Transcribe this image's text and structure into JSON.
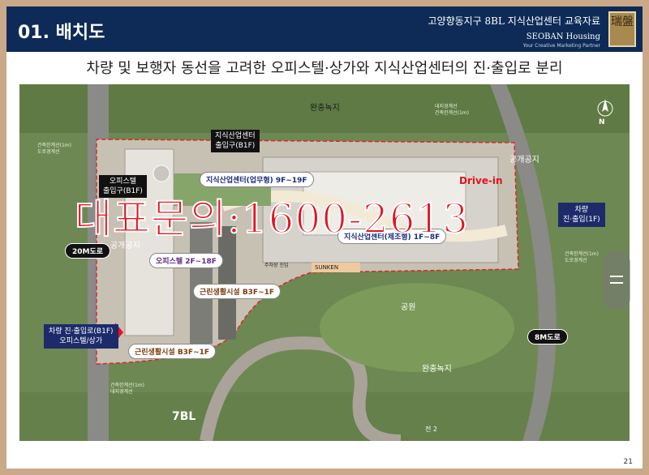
{
  "header": {
    "section_title": "01. 배치도",
    "document_title": "고양향동지구 8BL 지식산업센터 교육자료",
    "brand_name": "SEOBAN Housing",
    "brand_tagline": "Your Creative Marketing Partner",
    "seal_text": "瑞盤"
  },
  "subtitle": "차량 및 보행자 동선을 고려한 오피스텔·상가와 지식산업센터의 진·출입로 분리",
  "map": {
    "labels": {
      "buffer_green_top": "완충녹지",
      "buffer_green_bottom": "완충녹지",
      "park": "공원",
      "public_space_right": "공개공지",
      "public_space_left": "공개공지",
      "sunken": "SUNKEN",
      "block_7": "7BL",
      "drive_in": "Drive-in",
      "parking_entrance": "주차장 진입",
      "watermark": "대표문의:1600-2613",
      "north": "N"
    },
    "tags": {
      "kic_entrance": "지식산업센터\n출입구(B1F)",
      "officetel_entrance": "오피스텔\n출입구(B1F)",
      "vehicle_entrance": "차량 진·출입로(B1F)\n오피스텔/상가",
      "kic_entrance_right": "차량\n진·출입(1F)"
    },
    "chips": {
      "kic_office": "지식산업센터(업무형) 9F~19F",
      "kic_factory": "지식산업센터(제조형) 1F~8F",
      "officetel": "오피스텔 2F~18F",
      "retail_1": "근린생활시설 B3F~1F",
      "retail_2": "근린생활시설 B3F~1F"
    },
    "roads": {
      "road_20m": "20M도로",
      "road_8m": "8M도로"
    },
    "boundary_notes": {
      "top": "대지경계선\n건축한계선(1m)",
      "left": "건축한계선(1m)\n도로경계선",
      "right": "건축한계선(1m)\n도로경계선",
      "bottom": "건축한계선(1m)\n대지경계선"
    }
  },
  "footer": {
    "page_number": "21",
    "caption": "전 2"
  },
  "colors": {
    "header_bg": "#0e2b57",
    "frame": "#c9a98a",
    "watermark": "#e8121e",
    "boundary": "#e0242a"
  }
}
